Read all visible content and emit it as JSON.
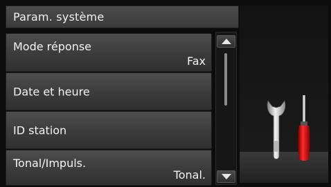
{
  "header": {
    "title": "Param. système"
  },
  "menu": {
    "items": [
      {
        "label": "Mode réponse",
        "value": "Fax"
      },
      {
        "label": "Date et heure",
        "value": ""
      },
      {
        "label": "ID station",
        "value": ""
      },
      {
        "label": "Tonal/Impuls.",
        "value": "Tonal."
      }
    ]
  },
  "scrollbar": {
    "up_icon": "triangle-up-icon",
    "down_icon": "triangle-down-icon",
    "position": 0.0
  },
  "graphic": {
    "icons": [
      "wrench-icon",
      "screwdriver-icon"
    ],
    "screwdriver_handle_color": "#cc1111"
  }
}
